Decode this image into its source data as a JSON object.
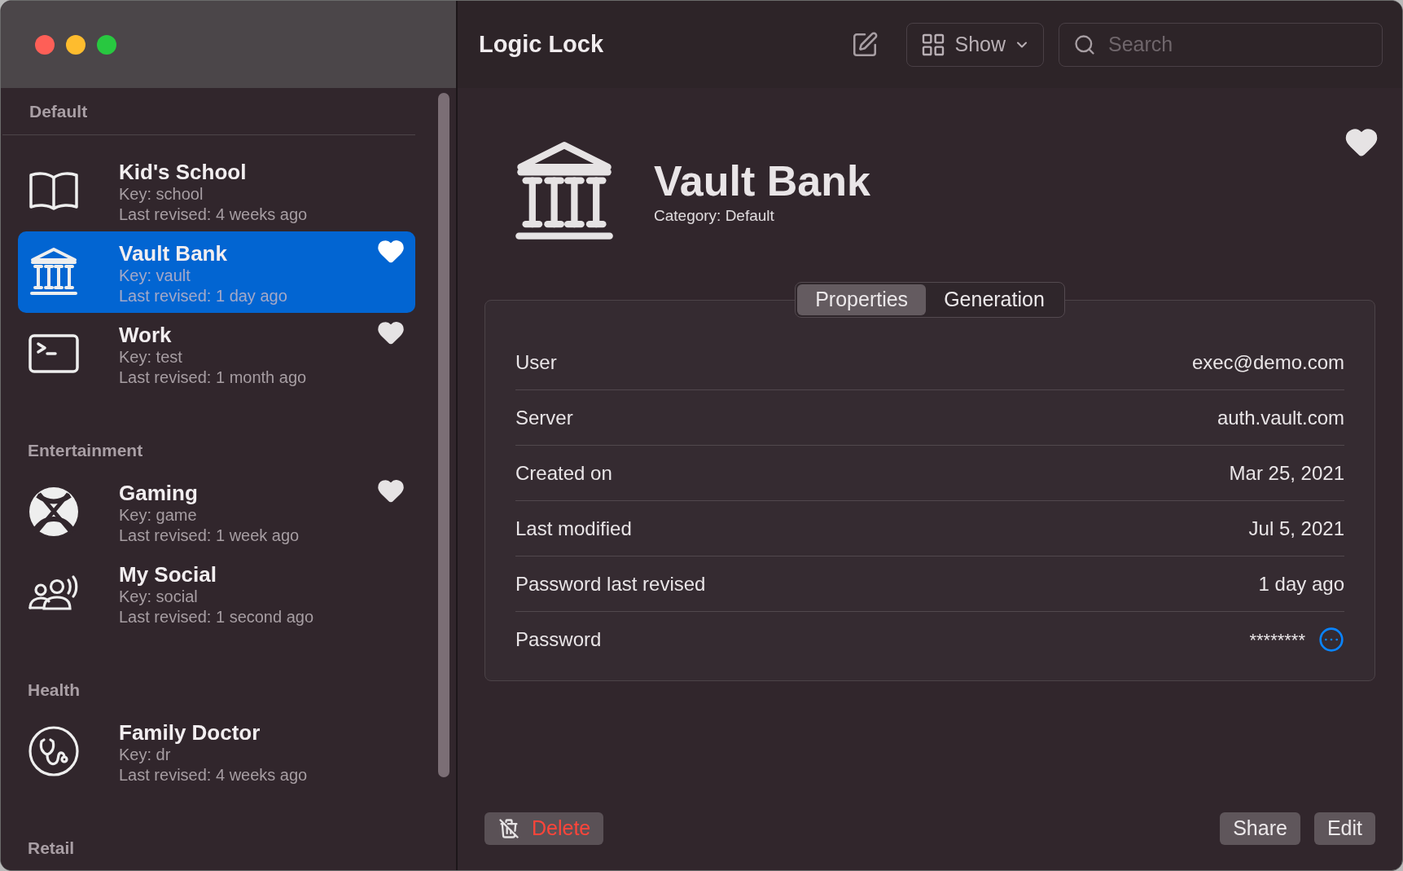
{
  "window": {
    "title": "Logic Lock"
  },
  "toolbar": {
    "view_button": "Show",
    "search": {
      "placeholder": "Search"
    }
  },
  "sidebar": {
    "sections": [
      {
        "title": "Default",
        "items": [
          {
            "name": "Kid's School",
            "key": "Key: school",
            "revised": "Last revised: 4 weeks ago",
            "favorite": false,
            "selected": false
          },
          {
            "name": "Vault Bank",
            "key": "Key: vault",
            "revised": "Last revised: 1 day ago",
            "favorite": true,
            "selected": true
          },
          {
            "name": "Work",
            "key": "Key: test",
            "revised": "Last revised: 1 month ago",
            "favorite": true,
            "selected": false
          }
        ]
      },
      {
        "title": "Entertainment",
        "items": [
          {
            "name": "Gaming",
            "key": "Key: game",
            "revised": "Last revised: 1 week ago",
            "favorite": true,
            "selected": false
          },
          {
            "name": "My Social",
            "key": "Key: social",
            "revised": "Last revised: 1 second ago",
            "favorite": false,
            "selected": false
          }
        ]
      },
      {
        "title": "Health",
        "items": [
          {
            "name": "Family Doctor",
            "key": "Key: dr",
            "revised": "Last revised: 4 weeks ago",
            "favorite": false,
            "selected": false
          }
        ]
      },
      {
        "title": "Retail"
      }
    ]
  },
  "detail": {
    "title": "Vault Bank",
    "category": "Category: Default",
    "favorite": true,
    "tabs": [
      {
        "label": "Properties",
        "selected": true
      },
      {
        "label": "Generation",
        "selected": false
      }
    ],
    "properties": [
      {
        "label": "User",
        "value": "exec@demo.com",
        "kind": "text"
      },
      {
        "label": "Server",
        "value": "auth.vault.com",
        "kind": "text"
      },
      {
        "label": "Created on",
        "value": "Mar 25, 2021",
        "kind": "text"
      },
      {
        "label": "Last modified",
        "value": "Jul 5, 2021",
        "kind": "text"
      },
      {
        "label": "Password last revised",
        "value": "1 day ago",
        "kind": "text"
      },
      {
        "label": "Password",
        "value": "********",
        "kind": "secret"
      }
    ],
    "buttons": {
      "delete": "Delete",
      "share": "Share",
      "edit": "Edit"
    }
  }
}
